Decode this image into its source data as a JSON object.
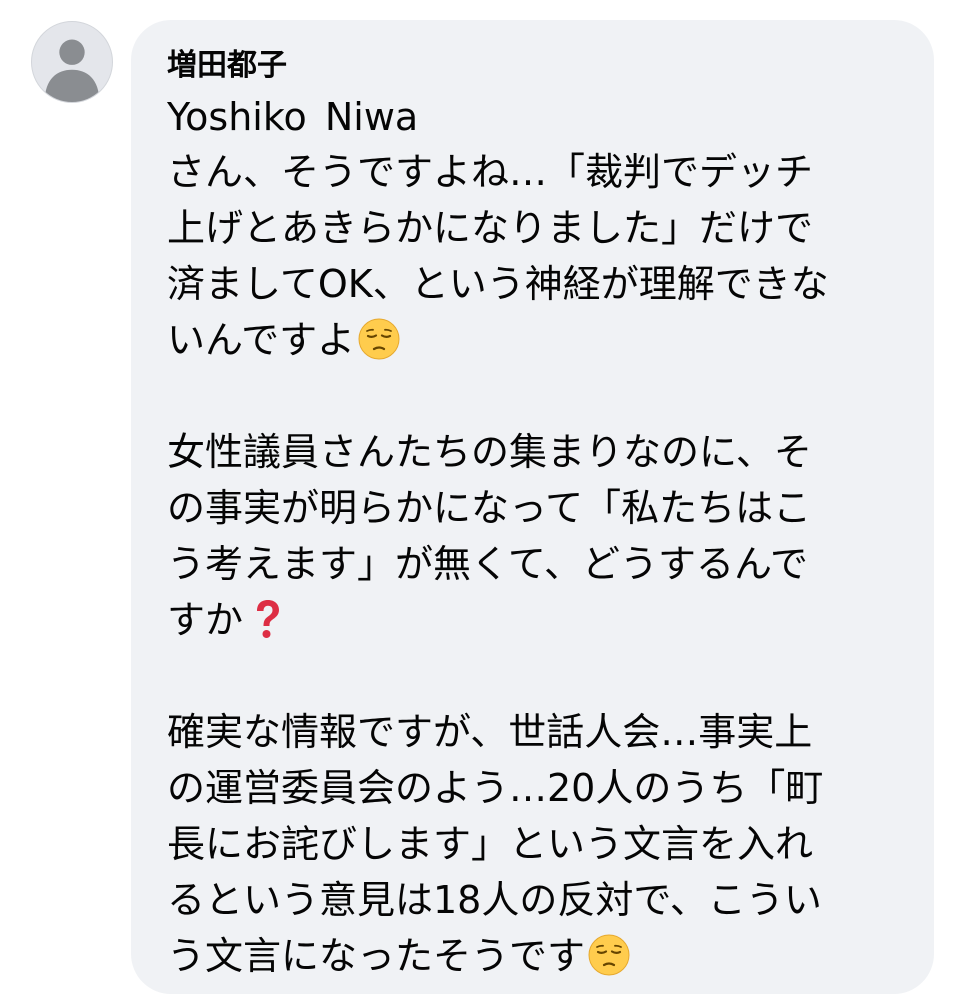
{
  "comment": {
    "author": "増田都子",
    "mention": "Yoshiko  Niwa",
    "paragraphs": [
      {
        "lines": [
          "さん、そうですよね…「裁判でデッチ",
          "上げとあきらかになりました」だけで",
          "済ましてOK、という神経が理解できな",
          "いんですよ"
        ],
        "end_emoji": "pensive-face-icon"
      },
      {
        "lines": [
          "女性議員さんたちの集まりなのに、そ",
          "の事実が明らかになって「私たちはこ",
          "う考えます」が無くて、どうするんで",
          "すか"
        ],
        "end_emoji": "red-question-mark-icon"
      },
      {
        "lines": [
          "確実な情報ですが、世話人会…事実上",
          "の運営委員会のよう…20人のうち「町",
          "長にお詫びします」という文言を入れ",
          "るという意見は18人の反対で、こうい",
          "う文言になったそうです"
        ],
        "end_emoji": "pensive-face-icon"
      }
    ]
  },
  "colors": {
    "bubble_background": "#f0f2f5",
    "text": "#050505",
    "avatar_background": "#e4e6eb",
    "avatar_silhouette": "#8a8d91"
  }
}
